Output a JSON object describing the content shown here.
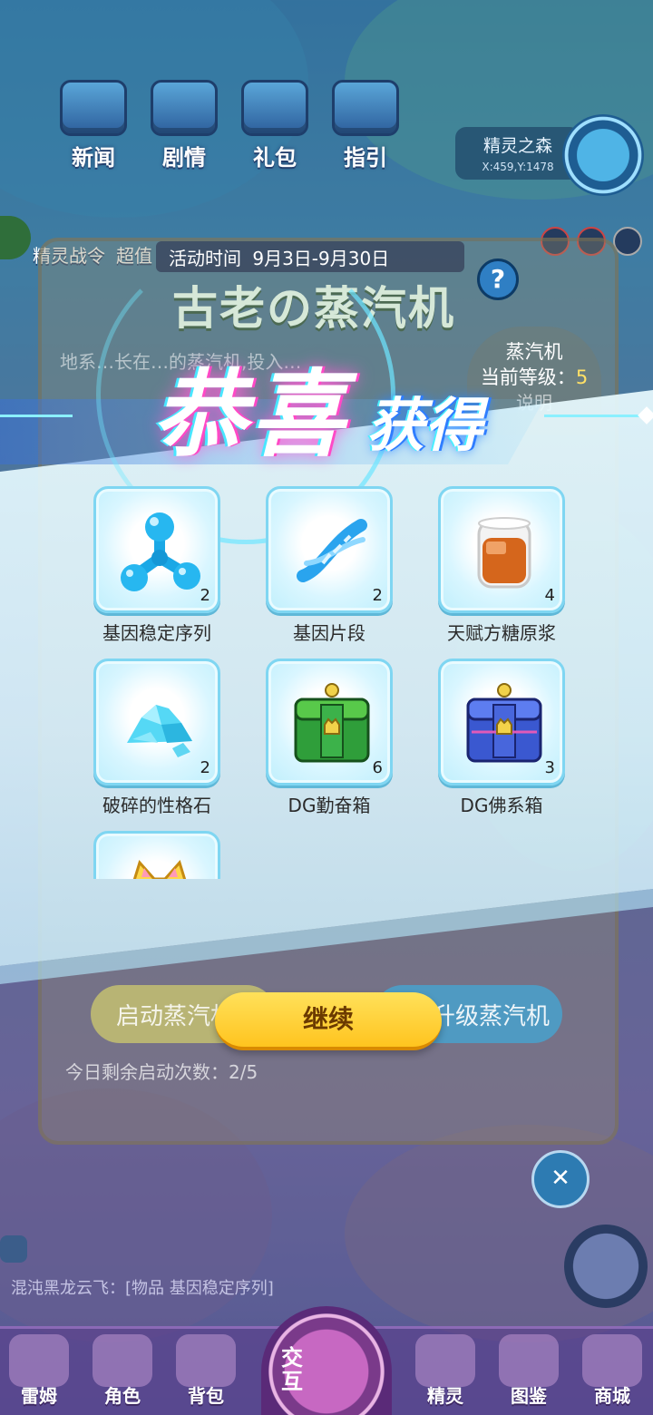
{
  "top_nav": [
    {
      "label": "新闻",
      "icon": "news-icon"
    },
    {
      "label": "剧情",
      "icon": "story-icon"
    },
    {
      "label": "礼包",
      "icon": "gift-pack-icon"
    },
    {
      "label": "指引",
      "icon": "guide-icon"
    }
  ],
  "location": {
    "name": "精灵之森",
    "coord": "X:459,Y:1478"
  },
  "second_row": {
    "battle_pass": "精灵战令",
    "super_value": "超值"
  },
  "event": {
    "time": "活动时间 9月3日-9月30日",
    "title": "古老の蒸汽机",
    "desc": "地系…长在…的蒸汽机,投入…",
    "engine_label": "蒸汽机",
    "level_label": "当前等级：",
    "level_value": "5",
    "explain": "说明",
    "start_button": "启动蒸汽机",
    "upgrade_button": "升级蒸汽机",
    "remaining": "今日剩余启动次数：2/5"
  },
  "popup": {
    "title_main": "恭喜",
    "title_sub": "获得",
    "continue_button": "继续",
    "items": [
      {
        "name": "基因稳定序列",
        "count": "2",
        "icon": "gene-molecule-icon"
      },
      {
        "name": "基因片段",
        "count": "2",
        "icon": "dna-icon"
      },
      {
        "name": "天赋方糖原浆",
        "count": "4",
        "icon": "syrup-jar-icon"
      },
      {
        "name": "破碎的性格石",
        "count": "2",
        "icon": "crystal-shards-icon"
      },
      {
        "name": "DG勤奋箱",
        "count": "6",
        "icon": "green-chest-icon"
      },
      {
        "name": "DG佛系箱",
        "count": "3",
        "icon": "blue-chest-icon"
      },
      {
        "name": "",
        "count": "",
        "icon": "cat-item-icon"
      }
    ]
  },
  "chat": {
    "message": "混沌黑龙云飞：[物品 基因稳定序列]"
  },
  "bottom_tabs": [
    {
      "label": "雷姆",
      "icon": "leim-icon"
    },
    {
      "label": "角色",
      "icon": "character-icon"
    },
    {
      "label": "背包",
      "icon": "backpack-icon"
    },
    {
      "label": "交互",
      "icon": "interact-icon"
    },
    {
      "label": "精灵",
      "icon": "spirit-icon"
    },
    {
      "label": "图鉴",
      "icon": "codex-icon"
    },
    {
      "label": "商城",
      "icon": "shop-icon"
    }
  ],
  "colors": {
    "accent_pink": "#ff49c6",
    "accent_cyan": "#49e6ff",
    "continue_yellow": "#ffc41f"
  }
}
